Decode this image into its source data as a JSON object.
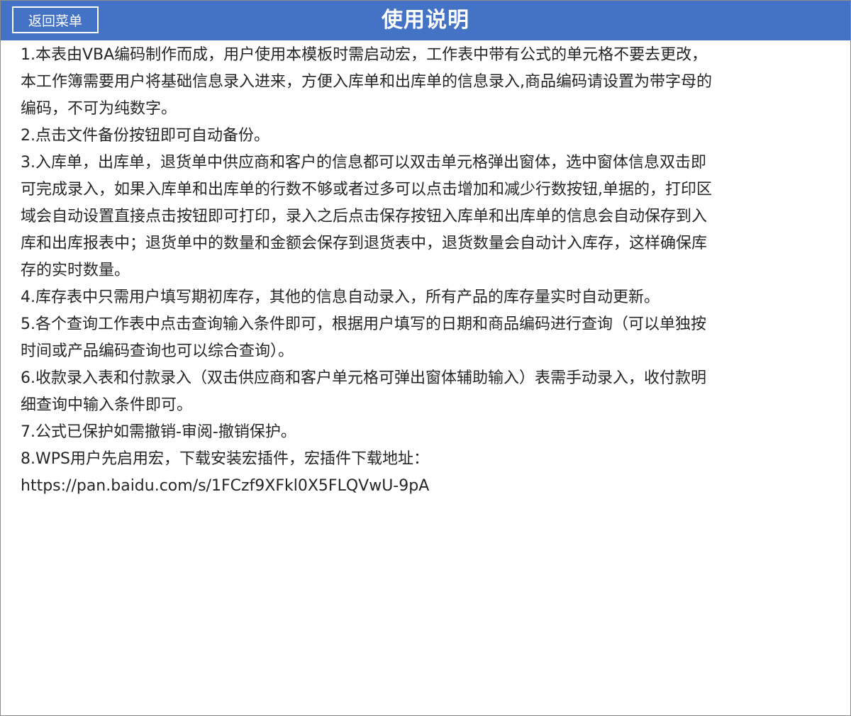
{
  "header": {
    "title": "使用说明",
    "back_button_label": "返回菜单",
    "background_color": "#4472c4"
  },
  "instructions": {
    "lines": [
      "1.本表由VBA编码制作而成，用户使用本模板时需启动宏，工作表中带有公式的单元格不要去更改，",
      "本工作簿需要用户将基础信息录入进来，方便入库单和出库单的信息录入,商品编码请设置为带字母的",
      "编码，不可为纯数字。",
      "2.点击文件备份按钮即可自动备份。",
      "3.入库单，出库单，退货单中供应商和客户的信息都可以双击单元格弹出窗体，选中窗体信息双击即",
      "可完成录入，如果入库单和出库单的行数不够或者过多可以点击增加和减少行数按钮,单据的，打印区",
      "域会自动设置直接点击按钮即可打印，录入之后点击保存按钮入库单和出库单的信息会自动保存到入",
      "库和出库报表中；退货单中的数量和金额会保存到退货表中，退货数量会自动计入库存，这样确保库",
      "存的实时数量。",
      "4.库存表中只需用户填写期初库存，其他的信息自动录入，所有产品的库存量实时自动更新。",
      "5.各个查询工作表中点击查询输入条件即可，根据用户填写的日期和商品编码进行查询（可以单独按",
      "时间或产品编码查询也可以综合查询）。",
      "6.收款录入表和付款录入（双击供应商和客户单元格可弹出窗体辅助输入）表需手动录入，收付款明",
      "细查询中输入条件即可。",
      "7.公式已保护如需撤销-审阅-撤销保护。",
      "8.WPS用户先启用宏，下载安装宏插件，宏插件下载地址：",
      "https://pan.baidu.com/s/1FCzf9XFkl0X5FLQVwU-9pA"
    ]
  }
}
